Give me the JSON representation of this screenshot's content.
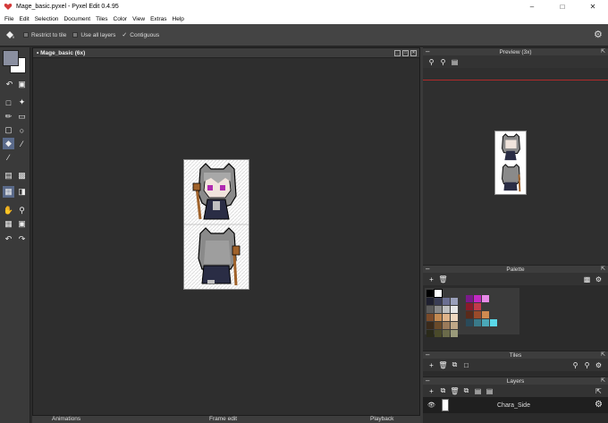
{
  "window": {
    "title": "Mage_basic.pyxel - Pyxel Edit 0.4.95",
    "icon": "pyxel-heart-icon"
  },
  "menu": [
    "File",
    "Edit",
    "Selection",
    "Document",
    "Tiles",
    "Color",
    "View",
    "Extras",
    "Help"
  ],
  "options": {
    "restrict_to_tile": {
      "label": "Restrict to tile",
      "checked": false
    },
    "use_all_layers": {
      "label": "Use all layers",
      "checked": false
    },
    "contiguous": {
      "label": "Contiguous",
      "checked": true
    }
  },
  "canvas": {
    "title": "• Mage_basic   (6x)"
  },
  "preview": {
    "title": "Preview (3x)"
  },
  "palette": {
    "title": "Palette",
    "colors_left": [
      "#000000",
      "#ffffff",
      null,
      null,
      "#1f2030",
      "#3a3d55",
      "#6b6f92",
      "#9aa0bb",
      "#5a5a5a",
      "#8a8a8a",
      "#c0c0c0",
      "#e6e6e6",
      "#7a4a2a",
      "#c48a52",
      "#e0b48a",
      "#f0d8c0",
      "#3a2a1a",
      "#6a4a2a",
      "#9a7a5a",
      "#c0a888",
      "#2a2a1a",
      "#4a4a2a",
      "#6a6a4a",
      "#9a9a7a"
    ],
    "colors_right": [
      "#7a1a8a",
      "#c22ac2",
      "#e88ae8",
      null,
      null,
      "#8a1a2a",
      "#c23a4a",
      null,
      null,
      null,
      "#5a2a1a",
      "#9a4a2a",
      "#d08a50",
      null,
      null,
      "#2a4a5a",
      "#3a7a8a",
      "#4aa8b8",
      "#5ad8e8",
      null
    ]
  },
  "tiles": {
    "title": "Tiles"
  },
  "layers": {
    "title": "Layers",
    "items": [
      {
        "name": "Chara_Side",
        "visible": true
      }
    ]
  },
  "bottom_tabs": [
    "Animations",
    "Frame edit",
    "Playback"
  ]
}
